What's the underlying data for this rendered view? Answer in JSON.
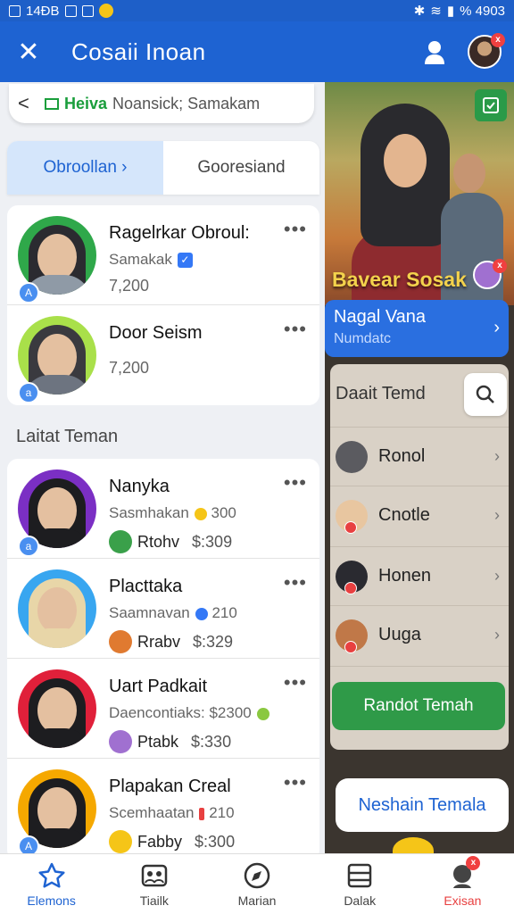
{
  "status_bar": {
    "left_text": "14ÐB",
    "right_text": "% 4903"
  },
  "header": {
    "title": "Cosaii Inoan"
  },
  "search": {
    "back_label": "<",
    "tag_label": "Heiva",
    "rest_text": "Noansick; Samakam"
  },
  "tabs": [
    {
      "label": "Obroollan ›"
    },
    {
      "label": "Gooresiand"
    }
  ],
  "top_list": [
    {
      "name": "Ragelrkar Obroul:",
      "sub": "Samakak",
      "num": "7,200",
      "ring": "#2fa84a",
      "hijab": "#2b2b30",
      "body": "#8f9aa6"
    },
    {
      "name": "Door Seism",
      "sub": "",
      "num": "7,200",
      "ring": "#a9e04a",
      "hijab": "#3a3a3f",
      "body": "#6d7480"
    }
  ],
  "section_title": "Laitat Teman",
  "friends": [
    {
      "name": "Nanyka",
      "sub": "Sasmhakan",
      "sub_num": "300",
      "handle": "Rtohv",
      "price": "$:309",
      "ring": "#7b2fc4",
      "hijab": "#1d1d20",
      "body": "#1d1d20",
      "mini": "#3aa04a",
      "icon_color": "#f5c518"
    },
    {
      "name": "Placttaka",
      "sub": "Saamnavan",
      "sub_num": "210",
      "handle": "Rrabv",
      "price": "$:329",
      "ring": "#38a6f0",
      "hijab": "#e8d6a8",
      "body": "#e8d6a8",
      "mini": "#e07a30",
      "icon_color": "#3478f6"
    },
    {
      "name": "Uart Padkait",
      "sub": "Daencontiaks:",
      "sub_num": "$2300",
      "handle": "Ptabk",
      "price": "$:330",
      "ring": "#e0203a",
      "hijab": "#1d1d20",
      "body": "#1d1d20",
      "mini": "#a070d0",
      "icon_color": "#8ac840"
    },
    {
      "name": "Plapakan Creal",
      "sub": "Scemhaatan",
      "sub_num": "210",
      "handle": "Fabby",
      "price": "$:300",
      "ring": "#f5a800",
      "hijab": "#1d1d20",
      "body": "#1d1d20",
      "mini": "#f5c518",
      "icon_color": "#e84040"
    }
  ],
  "right_panel": {
    "photo_caption": "Bavear Sosak",
    "feature": {
      "title": "Nagal Vana",
      "subtitle": "Numdatc"
    },
    "friends_title": "Daait Temd",
    "friends": [
      {
        "name": "Ronol",
        "color": "#5b5b60"
      },
      {
        "name": "Cnotle",
        "color": "#e8c6a0"
      },
      {
        "name": "Honen",
        "color": "#2a2a30"
      },
      {
        "name": "Uuga",
        "color": "#c07848"
      }
    ],
    "green_button": "Randot Temah",
    "white_button": "Neshain Temala"
  },
  "bottom_nav": [
    {
      "label": "Elemons",
      "icon": "star-icon"
    },
    {
      "label": "Tiailk",
      "icon": "people-icon"
    },
    {
      "label": "Marian",
      "icon": "compass-icon"
    },
    {
      "label": "Dalak",
      "icon": "list-icon"
    },
    {
      "label": "Exisan",
      "icon": "avatar-icon"
    }
  ],
  "colors": {
    "primary": "#1e63d2",
    "green": "#2f9a48",
    "badge_red": "#f04040"
  }
}
